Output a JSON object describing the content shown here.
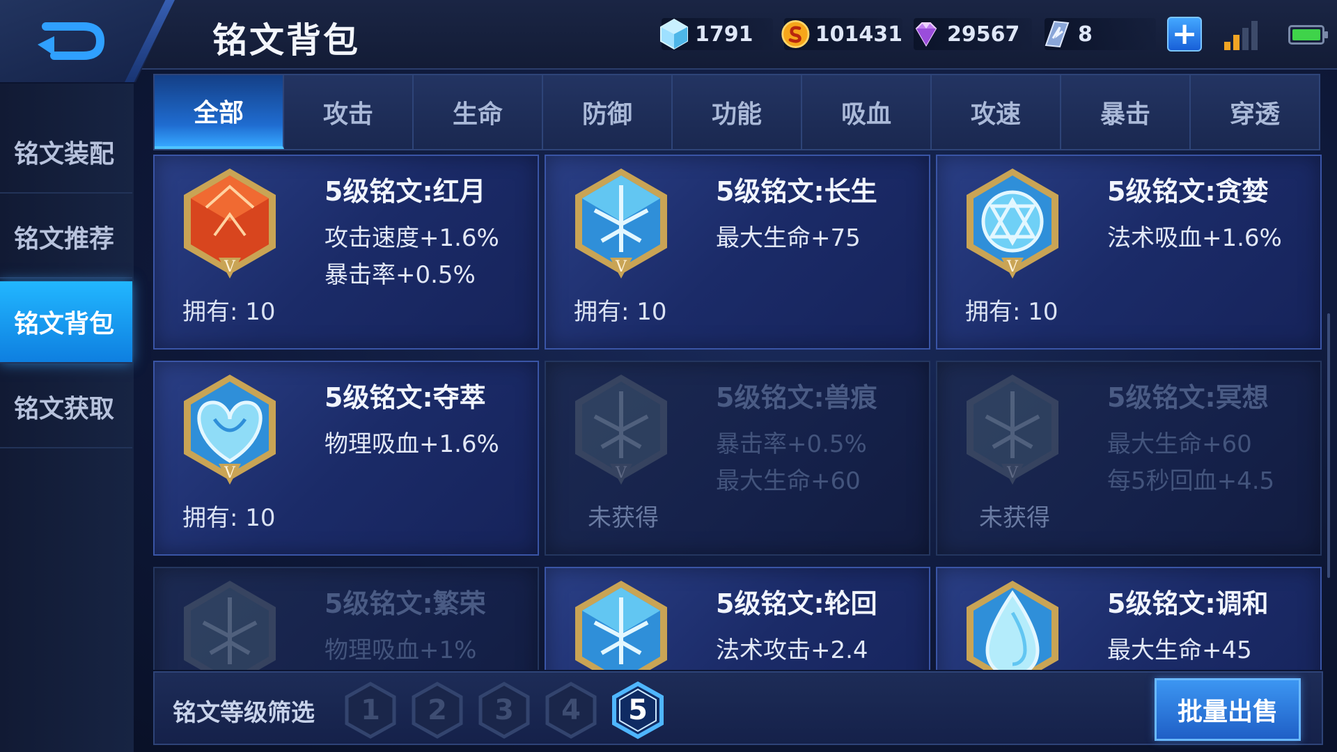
{
  "header": {
    "title": "铭文背包",
    "currencies": [
      {
        "icon": "diamond-icon",
        "value": "1791"
      },
      {
        "icon": "gold-coin-icon",
        "value": "101431"
      },
      {
        "icon": "gem-icon",
        "value": "29567"
      },
      {
        "icon": "crystal-icon",
        "value": "8"
      }
    ],
    "plus_label": "+"
  },
  "sidebar": {
    "items": [
      {
        "label": "铭文装配",
        "active": false
      },
      {
        "label": "铭文推荐",
        "active": false
      },
      {
        "label": "铭文背包",
        "active": true
      },
      {
        "label": "铭文获取",
        "active": false
      }
    ]
  },
  "tabs": [
    {
      "label": "全部",
      "active": true
    },
    {
      "label": "攻击",
      "active": false
    },
    {
      "label": "生命",
      "active": false
    },
    {
      "label": "防御",
      "active": false
    },
    {
      "label": "功能",
      "active": false
    },
    {
      "label": "吸血",
      "active": false
    },
    {
      "label": "攻速",
      "active": false
    },
    {
      "label": "暴击",
      "active": false
    },
    {
      "label": "穿透",
      "active": false
    }
  ],
  "cards": [
    {
      "name": "5级铭文:红月",
      "attrs": [
        "攻击速度+1.6%",
        "暴击率+0.5%"
      ],
      "owned": "拥有: 10",
      "locked": false,
      "emblem": "red-moon-icon"
    },
    {
      "name": "5级铭文:长生",
      "attrs": [
        "最大生命+75"
      ],
      "owned": "拥有: 10",
      "locked": false,
      "emblem": "longevity-icon"
    },
    {
      "name": "5级铭文:贪婪",
      "attrs": [
        "法术吸血+1.6%"
      ],
      "owned": "拥有: 10",
      "locked": false,
      "emblem": "greed-icon"
    },
    {
      "name": "5级铭文:夺萃",
      "attrs": [
        "物理吸血+1.6%"
      ],
      "owned": "拥有: 10",
      "locked": false,
      "emblem": "essence-icon"
    },
    {
      "name": "5级铭文:兽痕",
      "attrs": [
        "暴击率+0.5%",
        "最大生命+60"
      ],
      "owned": "未获得",
      "locked": true,
      "emblem": "beast-mark-icon"
    },
    {
      "name": "5级铭文:冥想",
      "attrs": [
        "最大生命+60",
        "每5秒回血+4.5"
      ],
      "owned": "未获得",
      "locked": true,
      "emblem": "meditation-icon"
    },
    {
      "name": "5级铭文:繁荣",
      "attrs": [
        "物理吸血+1%"
      ],
      "owned": "",
      "locked": true,
      "emblem": "prosperity-icon"
    },
    {
      "name": "5级铭文:轮回",
      "attrs": [
        "法术攻击+2.4"
      ],
      "owned": "",
      "locked": false,
      "emblem": "reincarnation-icon"
    },
    {
      "name": "5级铭文:调和",
      "attrs": [
        "最大生命+45"
      ],
      "owned": "",
      "locked": false,
      "emblem": "harmony-icon"
    }
  ],
  "filter": {
    "label": "铭文等级筛选",
    "levels": [
      "1",
      "2",
      "3",
      "4",
      "5"
    ],
    "selected": "5"
  },
  "batch_sell_label": "批量出售",
  "colors": {
    "accent": "#1e8fef",
    "red_emblem": "#d8451e",
    "blue_emblem": "#2f8fd9",
    "gold_frame": "#c9a455"
  }
}
